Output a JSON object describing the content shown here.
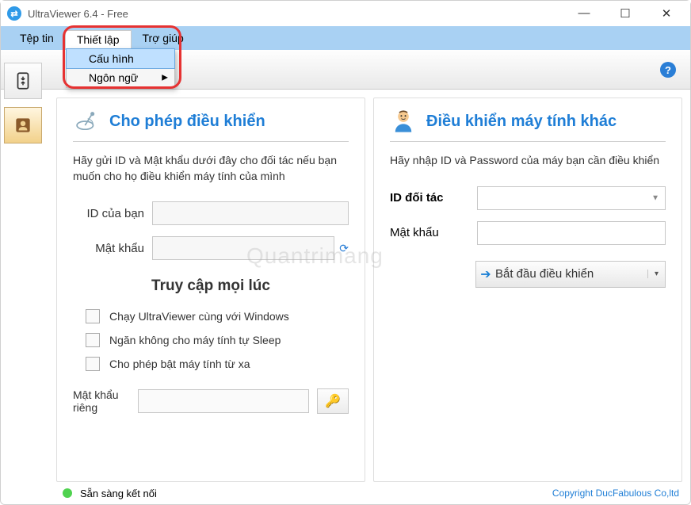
{
  "window": {
    "title": "UltraViewer 6.4 - Free"
  },
  "menu": {
    "file": "Tệp tin",
    "settings": "Thiết lập",
    "help": "Trợ giúp",
    "dropdown": {
      "config": "Cấu hình",
      "language": "Ngôn ngữ"
    }
  },
  "left_panel": {
    "title": "Cho phép điều khiển",
    "desc": "Hãy gửi ID và Mật khẩu dưới đây cho đối tác nếu bạn muốn cho họ điều khiển máy tính của mình",
    "id_label": "ID của bạn",
    "id_value": "",
    "pw_label": "Mật khẩu",
    "pw_value": "",
    "section": "Truy cập mọi lúc",
    "chk1": "Chạy UltraViewer cùng với Windows",
    "chk2": "Ngăn không cho máy tính tự Sleep",
    "chk3": "Cho phép bật máy tính từ xa",
    "privpw_label": "Mật khẩu riêng",
    "privpw_value": ""
  },
  "right_panel": {
    "title": "Điều khiển máy tính khác",
    "desc": "Hãy nhập ID và Password của máy bạn cần điều khiển",
    "partner_label": "ID đối tác",
    "partner_value": "",
    "pw_label": "Mật khẩu",
    "pw_value": "",
    "start_btn": "Bắt đầu điều khiển"
  },
  "status": {
    "ready": "Sẵn sàng kết nối",
    "copyright": "Copyright DucFabulous Co,ltd"
  },
  "watermark": "Quantrimang"
}
